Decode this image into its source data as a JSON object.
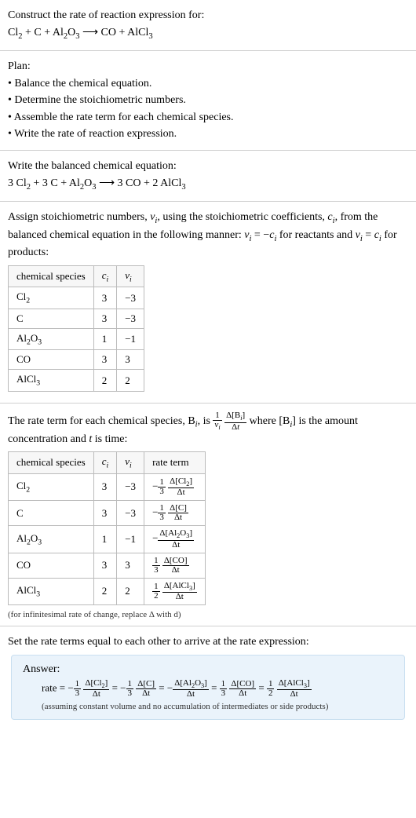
{
  "prompt": {
    "title": "Construct the rate of reaction expression for:",
    "equation_html": "Cl<sub>2</sub> + C + Al<sub>2</sub>O<sub>3</sub>  ⟶  CO + AlCl<sub>3</sub>"
  },
  "plan": {
    "heading": "Plan:",
    "items": [
      "• Balance the chemical equation.",
      "• Determine the stoichiometric numbers.",
      "• Assemble the rate term for each chemical species.",
      "• Write the rate of reaction expression."
    ]
  },
  "balanced": {
    "heading": "Write the balanced chemical equation:",
    "equation_html": "3 Cl<sub>2</sub> + 3 C + Al<sub>2</sub>O<sub>3</sub>  ⟶  3 CO + 2 AlCl<sub>3</sub>"
  },
  "stoich": {
    "intro_html": "Assign stoichiometric numbers, <i>ν<sub>i</sub></i>, using the stoichiometric coefficients, <i>c<sub>i</sub></i>, from the balanced chemical equation in the following manner: <i>ν<sub>i</sub></i> = −<i>c<sub>i</sub></i> for reactants and <i>ν<sub>i</sub></i> = <i>c<sub>i</sub></i> for products:",
    "headers": [
      "chemical species",
      "c_i",
      "ν_i"
    ],
    "headers_html": [
      "chemical species",
      "<i>c<sub>i</sub></i>",
      "<i>ν<sub>i</sub></i>"
    ],
    "rows": [
      {
        "species_html": "Cl<sub>2</sub>",
        "c": "3",
        "nu": "−3"
      },
      {
        "species_html": "C",
        "c": "3",
        "nu": "−3"
      },
      {
        "species_html": "Al<sub>2</sub>O<sub>3</sub>",
        "c": "1",
        "nu": "−1"
      },
      {
        "species_html": "CO",
        "c": "3",
        "nu": "3"
      },
      {
        "species_html": "AlCl<sub>3</sub>",
        "c": "2",
        "nu": "2"
      }
    ]
  },
  "rateterm": {
    "intro_pre": "The rate term for each chemical species, B",
    "intro_mid": ", is ",
    "intro_post_html": " where [B<sub><i>i</i></sub>] is the amount concentration and <i>t</i> is time:",
    "headers_html": [
      "chemical species",
      "<i>c<sub>i</sub></i>",
      "<i>ν<sub>i</sub></i>",
      "rate term"
    ],
    "rows": [
      {
        "species_html": "Cl<sub>2</sub>",
        "c": "3",
        "nu": "−3",
        "rate_sign": "−",
        "rate_coef_num": "1",
        "rate_coef_den": "3",
        "rate_dnum_html": "Δ[Cl<sub>2</sub>]",
        "rate_dden": "Δt"
      },
      {
        "species_html": "C",
        "c": "3",
        "nu": "−3",
        "rate_sign": "−",
        "rate_coef_num": "1",
        "rate_coef_den": "3",
        "rate_dnum_html": "Δ[C]",
        "rate_dden": "Δt"
      },
      {
        "species_html": "Al<sub>2</sub>O<sub>3</sub>",
        "c": "1",
        "nu": "−1",
        "rate_sign": "−",
        "rate_coef_num": "",
        "rate_coef_den": "",
        "rate_dnum_html": "Δ[Al<sub>2</sub>O<sub>3</sub>]",
        "rate_dden": "Δt"
      },
      {
        "species_html": "CO",
        "c": "3",
        "nu": "3",
        "rate_sign": "",
        "rate_coef_num": "1",
        "rate_coef_den": "3",
        "rate_dnum_html": "Δ[CO]",
        "rate_dden": "Δt"
      },
      {
        "species_html": "AlCl<sub>3</sub>",
        "c": "2",
        "nu": "2",
        "rate_sign": "",
        "rate_coef_num": "1",
        "rate_coef_den": "2",
        "rate_dnum_html": "Δ[AlCl<sub>3</sub>]",
        "rate_dden": "Δt"
      }
    ],
    "note": "(for infinitesimal rate of change, replace Δ with d)"
  },
  "final": {
    "heading": "Set the rate terms equal to each other to arrive at the rate expression:"
  },
  "answer": {
    "label": "Answer:",
    "prefix": "rate = ",
    "terms": [
      {
        "sign": "−",
        "coef_num": "1",
        "coef_den": "3",
        "dnum_html": "Δ[Cl<sub>2</sub>]",
        "dden": "Δt"
      },
      {
        "sign": "−",
        "coef_num": "1",
        "coef_den": "3",
        "dnum_html": "Δ[C]",
        "dden": "Δt"
      },
      {
        "sign": "−",
        "coef_num": "",
        "coef_den": "",
        "dnum_html": "Δ[Al<sub>2</sub>O<sub>3</sub>]",
        "dden": "Δt"
      },
      {
        "sign": "",
        "coef_num": "1",
        "coef_den": "3",
        "dnum_html": "Δ[CO]",
        "dden": "Δt"
      },
      {
        "sign": "",
        "coef_num": "1",
        "coef_den": "2",
        "dnum_html": "Δ[AlCl<sub>3</sub>]",
        "dden": "Δt"
      }
    ],
    "note": "(assuming constant volume and no accumulation of intermediates or side products)"
  },
  "chart_data": {
    "type": "table",
    "tables": [
      {
        "title": "stoichiometric numbers",
        "columns": [
          "chemical species",
          "c_i",
          "nu_i"
        ],
        "rows": [
          [
            "Cl2",
            3,
            -3
          ],
          [
            "C",
            3,
            -3
          ],
          [
            "Al2O3",
            1,
            -1
          ],
          [
            "CO",
            3,
            3
          ],
          [
            "AlCl3",
            2,
            2
          ]
        ]
      },
      {
        "title": "rate terms",
        "columns": [
          "chemical species",
          "c_i",
          "nu_i",
          "rate term"
        ],
        "rows": [
          [
            "Cl2",
            3,
            -3,
            "-(1/3) d[Cl2]/dt"
          ],
          [
            "C",
            3,
            -3,
            "-(1/3) d[C]/dt"
          ],
          [
            "Al2O3",
            1,
            -1,
            "- d[Al2O3]/dt"
          ],
          [
            "CO",
            3,
            3,
            "(1/3) d[CO]/dt"
          ],
          [
            "AlCl3",
            2,
            2,
            "(1/2) d[AlCl3]/dt"
          ]
        ]
      }
    ]
  }
}
